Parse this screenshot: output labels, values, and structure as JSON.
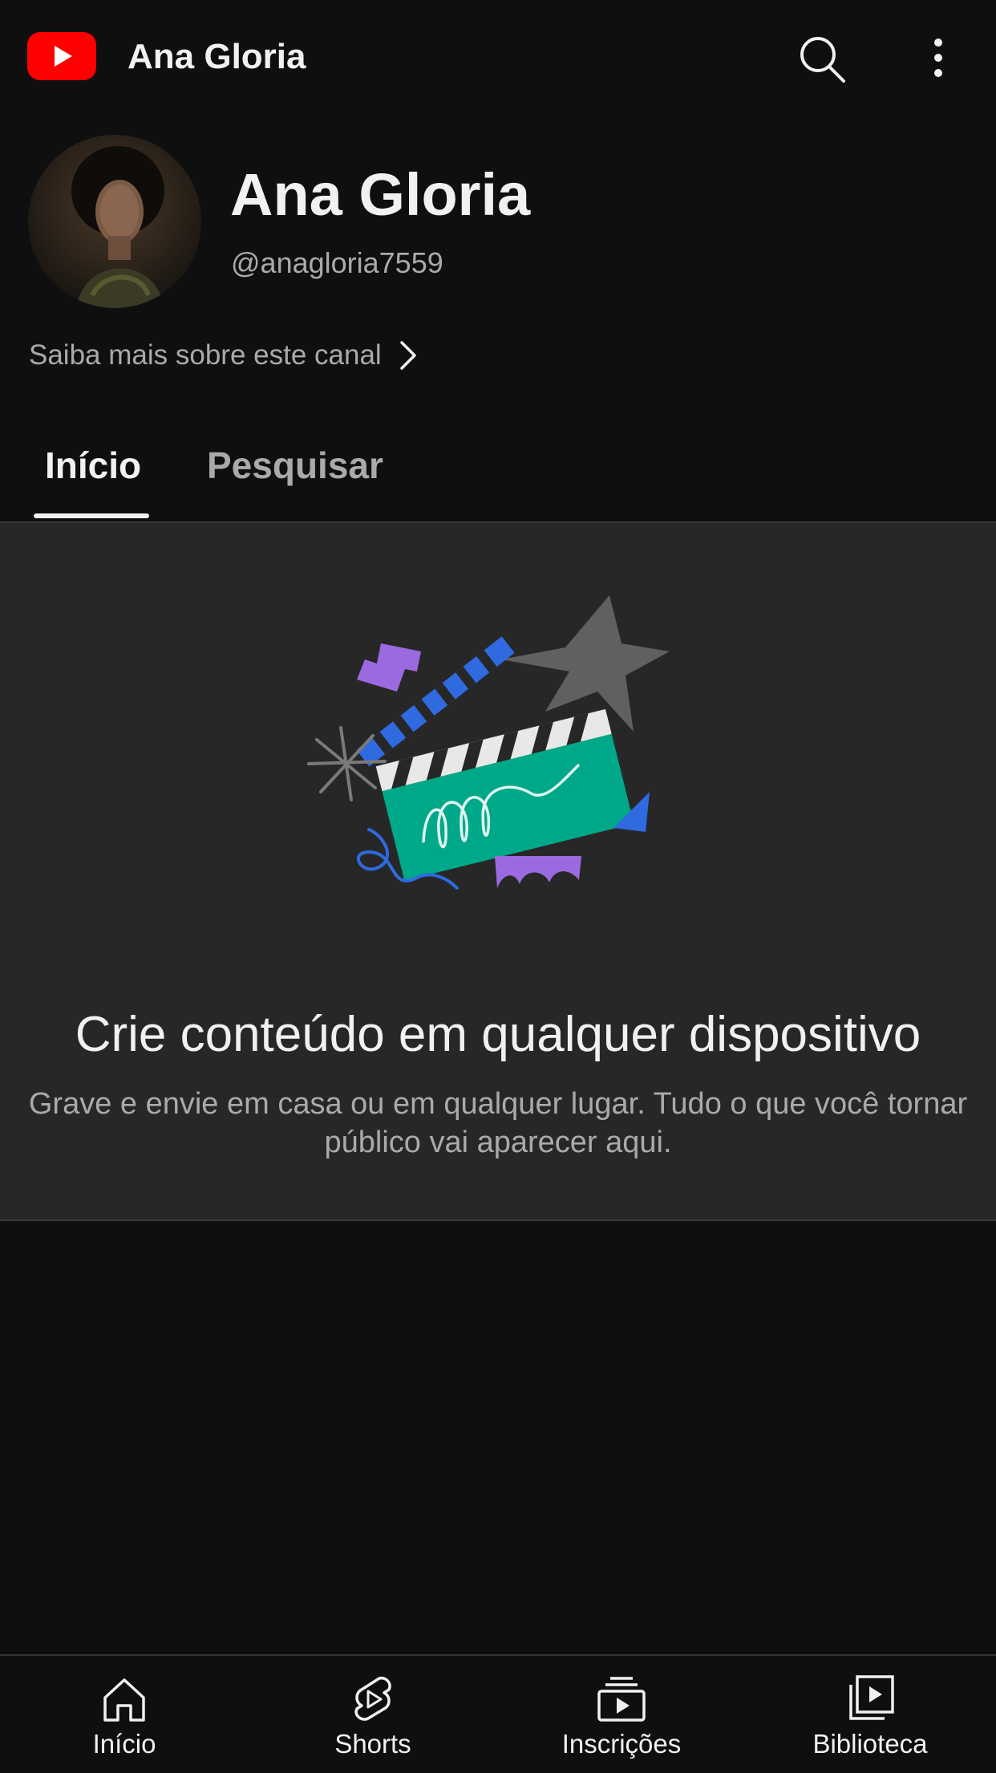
{
  "topbar": {
    "logo_icon": "youtube-logo-icon",
    "title": "Ana Gloria",
    "search_icon": "search-icon",
    "more_icon": "more-vertical-icon"
  },
  "channel": {
    "name": "Ana Gloria",
    "handle": "@anagloria7559",
    "about_label": "Saiba mais sobre este canal",
    "about_icon": "chevron-right-icon"
  },
  "tabs": [
    {
      "label": "Início",
      "selected": true
    },
    {
      "label": "Pesquisar",
      "selected": false
    }
  ],
  "empty_state": {
    "illustration_icon": "clapperboard-illustration",
    "title": "Crie conteúdo em qualquer dispositivo",
    "description": "Grave e envie em casa ou em qualquer lugar. Tudo o que você tornar público vai aparecer aqui."
  },
  "bottom_nav": [
    {
      "label": "Início",
      "icon": "home-icon"
    },
    {
      "label": "Shorts",
      "icon": "shorts-icon"
    },
    {
      "label": "Inscrições",
      "icon": "subscriptions-icon"
    },
    {
      "label": "Biblioteca",
      "icon": "library-icon"
    }
  ],
  "colors": {
    "background": "#0f0f0f",
    "panel": "#272727",
    "brand_red": "#ff0000",
    "text_primary": "#f1f1f1",
    "text_secondary": "#aaaaaa"
  }
}
